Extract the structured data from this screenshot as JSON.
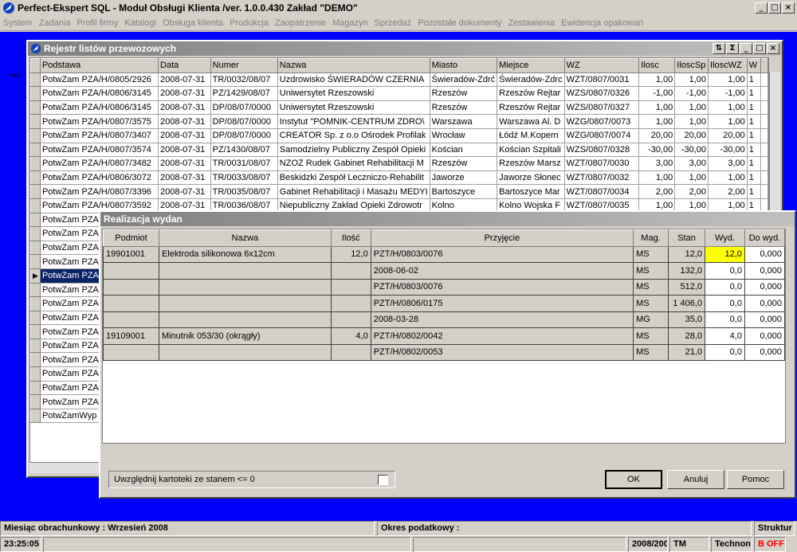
{
  "app_title": "Perfect-Ekspert SQL - Moduł Obsługi Klienta /ver. 1.0.0.430 Zakład \"DEMO\"",
  "menu": [
    "System",
    "Zadania",
    "Profil firmy",
    "Katalogi",
    "Obsługa klienta",
    "Produkcja",
    "Zaopatrzenie",
    "Magazyn",
    "Sprzedaż",
    "Pozostałe dokumenty",
    "Zestawienia",
    "Ewidencja opakowań"
  ],
  "desk_label": "ver",
  "rejestr": {
    "title": "Rejestr listów przewozowych",
    "columns": [
      "Podstawa",
      "Data",
      "Numer",
      "Nazwa",
      "Miasto",
      "Miejsce",
      "WZ",
      "Ilosc",
      "IloscSp",
      "IloscWZ",
      "W"
    ],
    "rows": [
      [
        "PotwZam PZA/H/0805/2926",
        "2008-07-31",
        "TR/0032/08/07",
        "Uzdrowisko ŚWIERADÓW CZERNIA",
        "Świeradów-Zdrć",
        "Świeradów-Zdrc",
        "WZT/0807/0031",
        "1,00",
        "1,00",
        "1,00",
        "1"
      ],
      [
        "PotwZam PZA/H/0806/3145",
        "2008-07-31",
        "PZ/1429/08/07",
        "Uniwersytet Rzeszowski",
        "Rzeszów",
        "Rzeszów Rejtar",
        "WZS/0807/0326",
        "-1,00",
        "-1,00",
        "-1,00",
        "1"
      ],
      [
        "PotwZam PZA/H/0806/3145",
        "2008-07-31",
        "DP/08/07/0000",
        "Uniwersytet Rzeszowski",
        "Rzeszów",
        "Rzeszów Rejtar",
        "WZS/0807/0327",
        "1,00",
        "1,00",
        "1,00",
        "1"
      ],
      [
        "PotwZam PZA/H/0807/3575",
        "2008-07-31",
        "DP/08/07/0000",
        "Instytut \"POMNIK-CENTRUM ZDRO\\",
        "Warszawa",
        "Warszawa Al. D",
        "WZG/0807/0073",
        "1,00",
        "1,00",
        "1,00",
        "1"
      ],
      [
        "PotwZam PZA/H/0807/3407",
        "2008-07-31",
        "DP/08/07/0000",
        "CREATOR Sp. z o.o Ośrodek Profilak",
        "Wrocław",
        "Łódź M.Kopern",
        "WZG/0807/0074",
        "20,00",
        "20,00",
        "20,00",
        "1"
      ],
      [
        "PotwZam PZA/H/0807/3574",
        "2008-07-31",
        "PZ/1430/08/07",
        "Samodzielny Publiczny Zespół Opieki",
        "Kościan",
        "Kościan Szpitali",
        "WZS/0807/0328",
        "-30,00",
        "-30,00",
        "-30,00",
        "1"
      ],
      [
        "PotwZam PZA/H/0807/3482",
        "2008-07-31",
        "TR/0031/08/07",
        "NZOZ Rudek Gabinet Rehabilitacji M",
        "Rzeszów",
        "Rzeszów Marsz",
        "WZT/0807/0030",
        "3,00",
        "3,00",
        "3,00",
        "1"
      ],
      [
        "PotwZam PZA/H/0806/3072",
        "2008-07-31",
        "TR/0033/08/07",
        "Beskidzki Zespół Leczniczo-Rehabilit",
        "Jaworze",
        "Jaworze Słonec",
        "WZT/0807/0032",
        "1,00",
        "1,00",
        "1,00",
        "1"
      ],
      [
        "PotwZam PZA/H/0807/3396",
        "2008-07-31",
        "TR/0035/08/07",
        "Gabinet Rehabilitacji i Masażu MEDYI",
        "Bartoszyce",
        "Bartoszyce Mar",
        "WZT/0807/0034",
        "2,00",
        "2,00",
        "2,00",
        "1"
      ],
      [
        "PotwZam PZA/H/0807/3592",
        "2008-07-31",
        "TR/0036/08/07",
        "Niepubliczny Zakład Opieki Zdrowotr",
        "Kolno",
        "Kolno Wojska F",
        "WZT/0807/0035",
        "1,00",
        "1,00",
        "1,00",
        "1"
      ]
    ],
    "stub_rows": [
      "PotwZam PZA/",
      "PotwZam PZA/",
      "PotwZam PZA/",
      "PotwZam PZA/",
      "PotwZam PZA/",
      "PotwZam PZA/",
      "PotwZam PZA/",
      "PotwZam PZA/",
      "PotwZam PZA/",
      "PotwZam PZA/",
      "PotwZam PZA/",
      "PotwZam PZA/",
      "PotwZam PZA/",
      "PotwZam PZA/",
      "PotwZamWyp F"
    ],
    "selected_stub": 4
  },
  "realizacja": {
    "title": "Realizacja wydan",
    "columns": [
      "Podmiot",
      "Nazwa",
      "Ilość",
      "Przyjęcie",
      "Mag.",
      "Stan",
      "Wyd.",
      "Do wyd."
    ],
    "rows": [
      [
        "19901001",
        "Elektroda silikonowa 6x12cm",
        "12,0",
        "PZT/H/0803/0076",
        "MS",
        "12,0",
        "12,0",
        "0,000"
      ],
      [
        "",
        "",
        "",
        "2008-06-02",
        "MS",
        "132,0",
        "0,0",
        "0,000"
      ],
      [
        "",
        "",
        "",
        "PZT/H/0803/0076",
        "MS",
        "512,0",
        "0,0",
        "0,000"
      ],
      [
        "",
        "",
        "",
        "PZT/H/0806/0175",
        "MS",
        "1 406,0",
        "0,0",
        "0,000"
      ],
      [
        "",
        "",
        "",
        "2008-03-28",
        "MG",
        "35,0",
        "0,0",
        "0,000"
      ],
      [
        "19109001",
        "Minutnik 053/30 (okrągły)",
        "4,0",
        "PZT/H/0802/0042",
        "MS",
        "28,0",
        "4,0",
        "0,000"
      ],
      [
        "",
        "",
        "",
        "PZT/H/0802/0053",
        "MS",
        "21,0",
        "0,0",
        "0,000"
      ]
    ],
    "checkbox_label": "Uwzględnij kartoteki ze stanem <= 0",
    "ok": "OK",
    "cancel": "Anuluj",
    "help": "Pomoc"
  },
  "status": {
    "month": "Miesiąc obrachunkowy : Wrzesień 2008",
    "tax": "Okres podatkowy :",
    "struct": "Struktur",
    "time": "23:25:05",
    "period": "2008/200",
    "tm": "TM",
    "techno": "Technon",
    "off": "B OFF"
  }
}
